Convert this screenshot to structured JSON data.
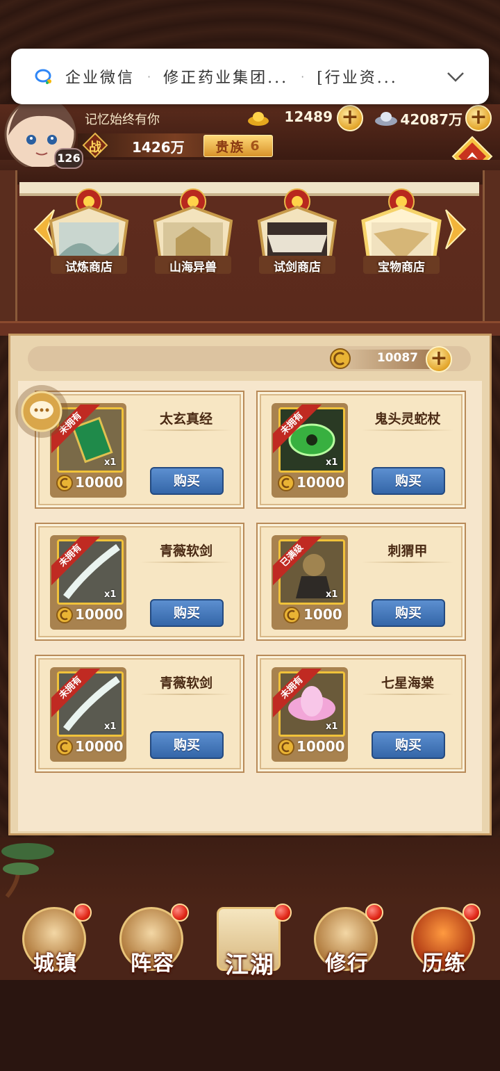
{
  "notification": {
    "app_name": "企业微信",
    "message": "修正药业集团...",
    "extra": "[行业资...",
    "separator": "·"
  },
  "player": {
    "name": "记忆始终有你",
    "level": "126",
    "gold": "12489",
    "silver": "42087万",
    "power_icon_text": "战",
    "power": "1426万",
    "noble_label": "贵族",
    "noble_level": "6"
  },
  "shop_tabs": [
    {
      "label": "试炼商店"
    },
    {
      "label": "山海异兽"
    },
    {
      "label": "试剑商店"
    },
    {
      "label": "宝物商店"
    }
  ],
  "currency": {
    "value": "10087"
  },
  "items": [
    {
      "name": "太玄真经",
      "price": "10000",
      "qty": "x1",
      "tag": "未拥有",
      "buy_label": "购买"
    },
    {
      "name": "鬼头灵蛇杖",
      "price": "10000",
      "qty": "x1",
      "tag": "未拥有",
      "buy_label": "购买"
    },
    {
      "name": "青薇软剑",
      "price": "10000",
      "qty": "x1",
      "tag": "未拥有",
      "buy_label": "购买"
    },
    {
      "name": "刺猬甲",
      "price": "1000",
      "qty": "x1",
      "tag": "已满级",
      "buy_label": "购买"
    },
    {
      "name": "青薇软剑",
      "price": "10000",
      "qty": "x1",
      "tag": "未拥有",
      "buy_label": "购买"
    },
    {
      "name": "七星海棠",
      "price": "10000",
      "qty": "x1",
      "tag": "未拥有",
      "buy_label": "购买"
    }
  ],
  "nav": [
    {
      "label": "城镇"
    },
    {
      "label": "阵容"
    },
    {
      "label": "江湖"
    },
    {
      "label": "修行"
    },
    {
      "label": "历练"
    }
  ],
  "colors": {
    "accent_gold": "#e3a52a",
    "buy_blue": "#3466a8",
    "ribbon_red": "#c02a22"
  }
}
